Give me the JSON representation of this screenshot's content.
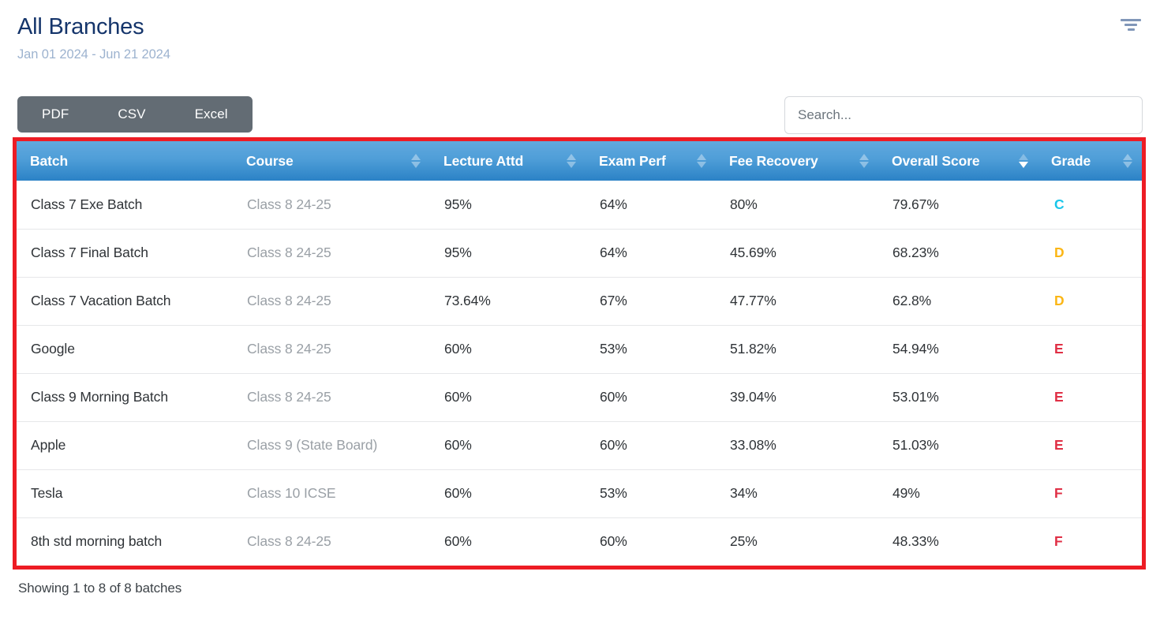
{
  "header": {
    "title": "All Branches",
    "date_range": "Jan 01 2024 - Jun 21 2024",
    "filter_icon": "filter-funnel-icon"
  },
  "toolbar": {
    "export_buttons": [
      {
        "label": "PDF"
      },
      {
        "label": "CSV"
      },
      {
        "label": "Excel"
      }
    ],
    "search": {
      "placeholder": "Search...",
      "value": ""
    }
  },
  "table": {
    "columns": [
      {
        "label": "Batch",
        "sortable": false,
        "sort": "none"
      },
      {
        "label": "Course",
        "sortable": true,
        "sort": "none"
      },
      {
        "label": "Lecture Attd",
        "sortable": true,
        "sort": "none"
      },
      {
        "label": "Exam Perf",
        "sortable": true,
        "sort": "none"
      },
      {
        "label": "Fee Recovery",
        "sortable": true,
        "sort": "none"
      },
      {
        "label": "Overall Score",
        "sortable": true,
        "sort": "desc"
      },
      {
        "label": "Grade",
        "sortable": true,
        "sort": "none"
      }
    ],
    "rows": [
      {
        "batch": "Class 7 Exe Batch",
        "course": "Class 8 24-25",
        "lecture_attd": "95%",
        "exam_perf": "64%",
        "fee_recovery": "80%",
        "overall_score": "79.67%",
        "grade": "C",
        "grade_color": "#1ac6ea"
      },
      {
        "batch": "Class 7 Final Batch",
        "course": "Class 8 24-25",
        "lecture_attd": "95%",
        "exam_perf": "64%",
        "fee_recovery": "45.69%",
        "overall_score": "68.23%",
        "grade": "D",
        "grade_color": "#fbb615"
      },
      {
        "batch": "Class 7 Vacation Batch",
        "course": "Class 8 24-25",
        "lecture_attd": "73.64%",
        "exam_perf": "67%",
        "fee_recovery": "47.77%",
        "overall_score": "62.8%",
        "grade": "D",
        "grade_color": "#fbb615"
      },
      {
        "batch": "Google",
        "course": "Class 8 24-25",
        "lecture_attd": "60%",
        "exam_perf": "53%",
        "fee_recovery": "51.82%",
        "overall_score": "54.94%",
        "grade": "E",
        "grade_color": "#e02f45"
      },
      {
        "batch": "Class 9 Morning Batch",
        "course": "Class 8 24-25",
        "lecture_attd": "60%",
        "exam_perf": "60%",
        "fee_recovery": "39.04%",
        "overall_score": "53.01%",
        "grade": "E",
        "grade_color": "#e02f45"
      },
      {
        "batch": "Apple",
        "course": "Class 9 (State Board)",
        "lecture_attd": "60%",
        "exam_perf": "60%",
        "fee_recovery": "33.08%",
        "overall_score": "51.03%",
        "grade": "E",
        "grade_color": "#e02f45"
      },
      {
        "batch": "Tesla",
        "course": "Class 10 ICSE",
        "lecture_attd": "60%",
        "exam_perf": "53%",
        "fee_recovery": "34%",
        "overall_score": "49%",
        "grade": "F",
        "grade_color": "#e02f45"
      },
      {
        "batch": "8th std morning batch",
        "course": "Class 8 24-25",
        "lecture_attd": "60%",
        "exam_perf": "60%",
        "fee_recovery": "25%",
        "overall_score": "48.33%",
        "grade": "F",
        "grade_color": "#e02f45"
      }
    ],
    "highlight_border_color": "#ed1c24"
  },
  "footer": {
    "showing_text": "Showing 1 to 8 of 8 batches"
  }
}
